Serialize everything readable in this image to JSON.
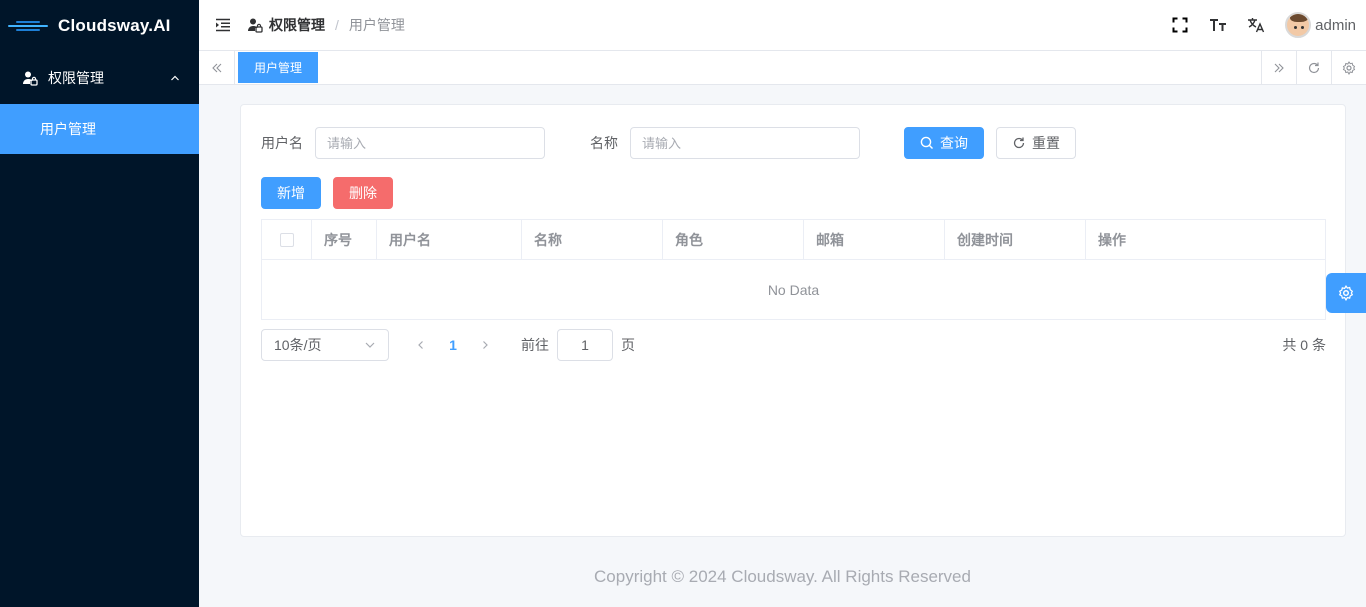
{
  "app": {
    "brand": "Cloudsway.AI"
  },
  "sidebar": {
    "group": {
      "label": "权限管理",
      "icon": "user-lock-icon"
    },
    "items": [
      {
        "label": "用户管理",
        "active": true
      }
    ]
  },
  "header": {
    "breadcrumb": [
      "权限管理",
      "用户管理"
    ],
    "separator": "/",
    "user": {
      "name": "admin"
    },
    "icons": [
      "fullscreen-icon",
      "font-size-icon",
      "translate-icon"
    ]
  },
  "tags": {
    "items": [
      "用户管理"
    ]
  },
  "search": {
    "username_label": "用户名",
    "username_placeholder": "请输入",
    "name_label": "名称",
    "name_placeholder": "请输入",
    "query_label": "查询",
    "reset_label": "重置"
  },
  "actions": {
    "add_label": "新增",
    "delete_label": "删除"
  },
  "table": {
    "columns": [
      "序号",
      "用户名",
      "名称",
      "角色",
      "邮箱",
      "创建时间",
      "操作"
    ],
    "empty_text": "No Data"
  },
  "pagination": {
    "page_size": "10条/页",
    "current_page": "1",
    "goto_label": "前往",
    "goto_value": "1",
    "page_unit": "页",
    "total_text": "共 0 条"
  },
  "footer": {
    "copyright": "Copyright © 2024 Cloudsway. All Rights Reserved"
  },
  "colors": {
    "primary": "#409eff",
    "danger": "#f56c6c",
    "sidebar_bg": "#001529"
  }
}
